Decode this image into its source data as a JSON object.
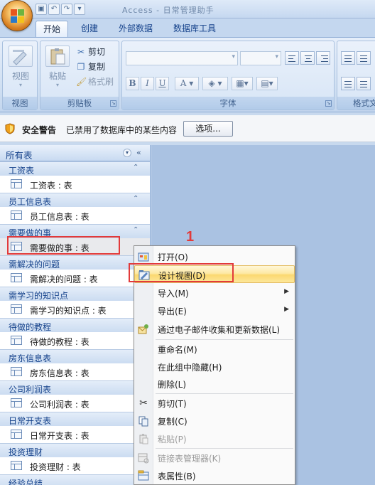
{
  "titlebar": {
    "title": "Access - 日常管理助手"
  },
  "ribbon": {
    "tabs": [
      "开始",
      "创建",
      "外部数据",
      "数据库工具"
    ],
    "groups": {
      "view": {
        "label": "视图",
        "button": "视图"
      },
      "clipboard": {
        "label": "剪贴板",
        "paste": "粘贴",
        "cut": "剪切",
        "copy": "复制",
        "format_painter": "格式刷"
      },
      "font": {
        "label": "字体"
      },
      "format": {
        "label": "格式文"
      }
    }
  },
  "security_bar": {
    "title": "安全警告",
    "message": "已禁用了数据库中的某些内容",
    "options_button": "选项..."
  },
  "nav_pane": {
    "header": "所有表",
    "groups": [
      {
        "name": "工资表",
        "item": "工资表 : 表"
      },
      {
        "name": "员工信息表",
        "item": "员工信息表 : 表"
      },
      {
        "name": "需要做的事",
        "item": "需要做的事 : 表"
      },
      {
        "name": "需解决的问题",
        "item": "需解决的问题 : 表"
      },
      {
        "name": "需学习的知识点",
        "item": "需学习的知识点 : 表"
      },
      {
        "name": "待做的教程",
        "item": "待做的教程 : 表"
      },
      {
        "name": "房东信息表",
        "item": "房东信息表 : 表"
      },
      {
        "name": "公司利润表",
        "item": "公司利润表 : 表"
      },
      {
        "name": "日常开支表",
        "item": "日常开支表 : 表"
      },
      {
        "name": "投资理财",
        "item": "投资理财 : 表"
      },
      {
        "name": "经验总结",
        "item": ""
      }
    ]
  },
  "context_menu": {
    "items": [
      {
        "label": "打开(O)",
        "icon": "open-icon"
      },
      {
        "label": "设计视图(D)",
        "icon": "design-view-icon"
      },
      {
        "label": "导入(M)",
        "submenu": true
      },
      {
        "label": "导出(E)",
        "submenu": true
      },
      {
        "label": "通过电子邮件收集和更新数据(L)",
        "icon": "email-collect-icon"
      },
      {
        "label": "重命名(M)"
      },
      {
        "label": "在此组中隐藏(H)"
      },
      {
        "label": "删除(L)"
      },
      {
        "label": "剪切(T)",
        "icon": "scissors-icon"
      },
      {
        "label": "复制(C)",
        "icon": "copy-icon"
      },
      {
        "label": "粘贴(P)",
        "icon": "paste-icon",
        "disabled": true
      },
      {
        "label": "链接表管理器(K)",
        "icon": "linked-table-manager-icon",
        "disabled": true
      },
      {
        "label": "表属性(B)",
        "icon": "table-properties-icon"
      }
    ]
  },
  "annotation": {
    "step_number": "1"
  },
  "colors": {
    "highlight_box": "#e23a3a",
    "ribbon_blue": "#15428b",
    "menu_highlight": "#fbd871"
  }
}
